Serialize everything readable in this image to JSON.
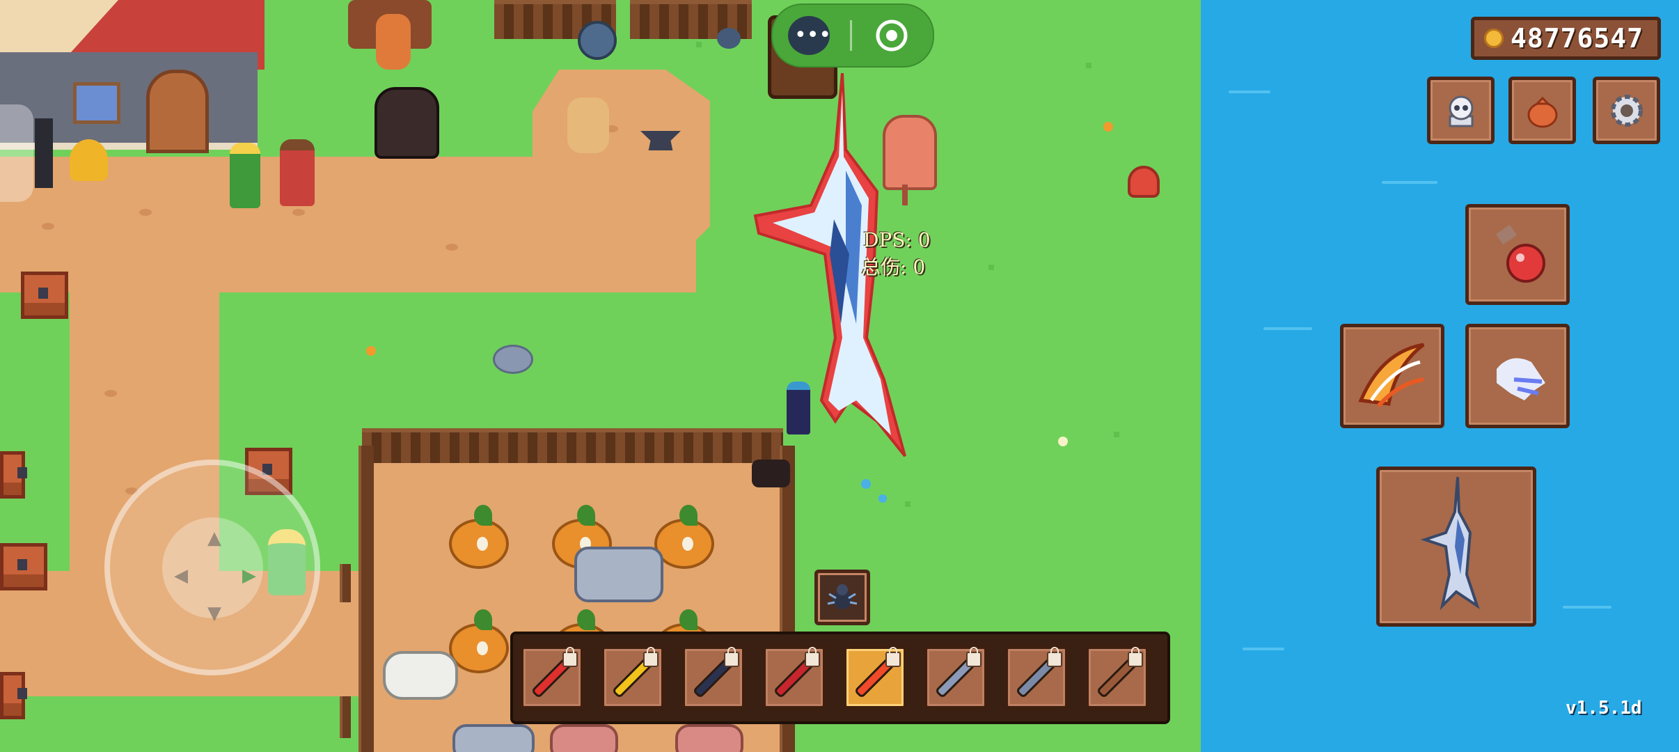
{
  "hud": {
    "coins": "48776547",
    "version": "v1.5.1d"
  },
  "combat": {
    "dps_text": "DPS: 0",
    "total_damage_text": "总伤: 0"
  },
  "top_buttons": {
    "icons": [
      "more-icon",
      "record-icon"
    ]
  },
  "right_menu": {
    "buttons": [
      "skull-icon",
      "bag-icon",
      "gear-icon"
    ],
    "skills": [
      "potion-icon",
      "fire-claw-icon",
      "ghost-dash-icon"
    ],
    "equipped": "swordfish-weapon-icon"
  },
  "hotbar": {
    "slots": [
      {
        "icon": "red-staff-icon",
        "locked": true,
        "active": false
      },
      {
        "icon": "golden-key-wand-icon",
        "locked": true,
        "active": false
      },
      {
        "icon": "dark-dagger-icon",
        "locked": true,
        "active": false
      },
      {
        "icon": "crimson-spear-icon",
        "locked": true,
        "active": false
      },
      {
        "icon": "flame-sword-icon",
        "locked": true,
        "active": true
      },
      {
        "icon": "crystal-blaster-icon",
        "locked": true,
        "active": false
      },
      {
        "icon": "battle-axe-icon",
        "locked": true,
        "active": false
      },
      {
        "icon": "pickaxe-icon",
        "locked": true,
        "active": false
      }
    ]
  },
  "colors": {
    "grass": "#6fd15a",
    "path": "#e3a66e",
    "water": "#27a9e6",
    "hud_wood": "#a86a4a",
    "active_slot": "#e8a43a"
  }
}
